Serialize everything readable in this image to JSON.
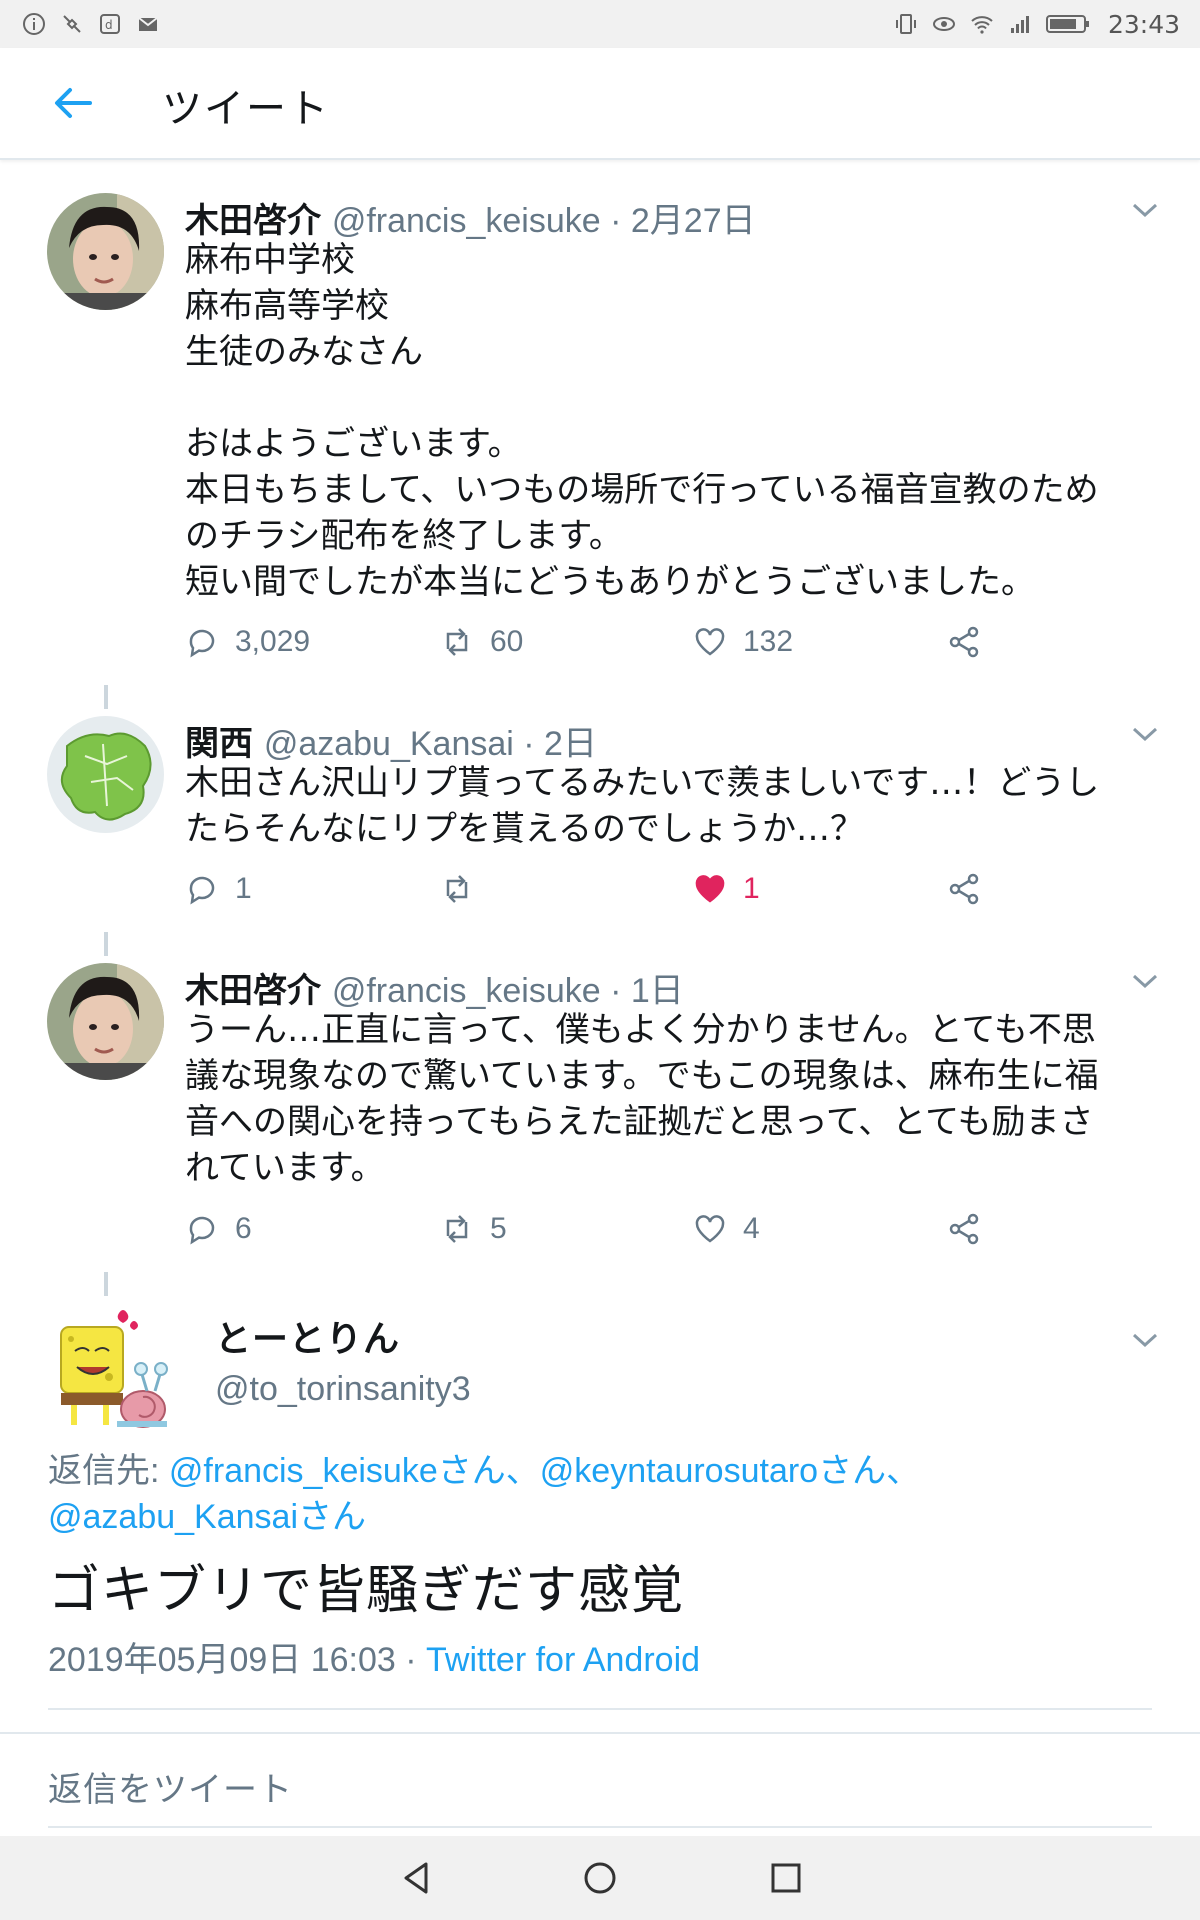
{
  "status_bar": {
    "time": "23:43"
  },
  "header": {
    "title": "ツイート"
  },
  "tweets": [
    {
      "name": "木田啓介",
      "meta": "@francis_keisuke · 2月27日",
      "body": "麻布中学校\n麻布高等学校\n生徒のみなさん\n\nおはようございます。\n本日もちまして、いつもの場所で行っている福音宣教のため\nのチラシ配布を終了します。\n短い間でしたが本当にどうもありがとうございました。",
      "replies": "3,029",
      "retweets": "60",
      "likes": "132"
    },
    {
      "name": "関西",
      "meta": "@azabu_Kansai · 2日",
      "body": "木田さん沢山リプ貰ってるみたいで羨ましいです…！どうし\nたらそんなにリプを貰えるのでしょうか…？",
      "replies": "1",
      "retweets": "",
      "likes": "1"
    },
    {
      "name": "木田啓介",
      "meta": "@francis_keisuke · 1日",
      "body": "うーん…正直に言って、僕もよく分かりません。とても不思\n議な現象なので驚いています。でもこの現象は、麻布生に福\n音への関心を持ってもらえた証拠だと思って、とても励まさ\nれています。",
      "replies": "6",
      "retweets": "5",
      "likes": "4"
    }
  ],
  "focused": {
    "name": "とーとりん",
    "handle": "@to_torinsanity3",
    "reply_prefix": "返信先: ",
    "reply_to_1": "@francis_keisukeさん、",
    "reply_to_2": "@keyntaurosutaroさん、",
    "reply_to_3": "@azabu_Kansaiさん",
    "text": "ゴキブリで皆騒ぎだす感覚",
    "datetime": "2019年05月09日 16:03 · ",
    "source": "Twitter for Android"
  },
  "reply_placeholder": "返信をツイート",
  "colors": {
    "accent": "#1da1f2",
    "like": "#e0245e",
    "muted": "#657786"
  }
}
